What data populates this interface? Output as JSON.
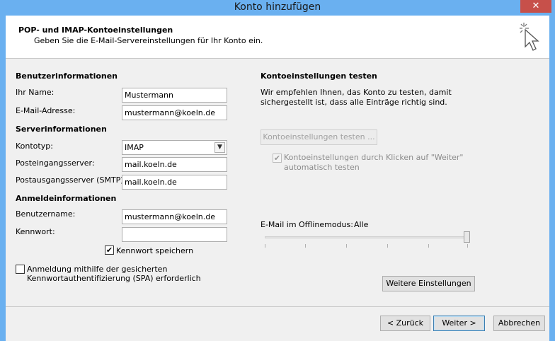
{
  "window": {
    "title": "Konto hinzufügen",
    "close_glyph": "✕"
  },
  "header": {
    "title": "POP- und IMAP-Kontoeinstellungen",
    "subtitle": "Geben Sie die E-Mail-Servereinstellungen für Ihr Konto ein.",
    "icon": "wizard-cursor-icon"
  },
  "user_info": {
    "section": "Benutzerinformationen",
    "name_label": "Ihr Name:",
    "name_value": "Mustermann",
    "email_label": "E-Mail-Adresse:",
    "email_value": "mustermann@koeln.de"
  },
  "server_info": {
    "section": "Serverinformationen",
    "account_type_label": "Kontotyp:",
    "account_type_value": "IMAP",
    "incoming_label": "Posteingangsserver:",
    "incoming_value": "mail.koeln.de",
    "outgoing_label": "Postausgangsserver (SMTP):",
    "outgoing_value": "mail.koeln.de"
  },
  "login_info": {
    "section": "Anmeldeinformationen",
    "username_label": "Benutzername:",
    "username_value": "mustermann@koeln.de",
    "password_label": "Kennwort:",
    "password_value": "",
    "remember_label": "Kennwort speichern",
    "remember_checked": true,
    "spa_label_line1": "Anmeldung mithilfe der gesicherten",
    "spa_label_line2": "Kennwortauthentifizierung (SPA) erforderlich",
    "spa_checked": false
  },
  "test": {
    "section": "Kontoeinstellungen testen",
    "desc_line1": "Wir empfehlen Ihnen, das Konto zu testen, damit",
    "desc_line2": "sichergestellt ist, dass alle Einträge richtig sind.",
    "test_button": "Kontoeinstellungen testen ...",
    "auto_label_line1": "Kontoeinstellungen durch Klicken auf \"Weiter\"",
    "auto_label_line2": "automatisch testen",
    "auto_checked": true
  },
  "offline": {
    "label": "E-Mail im Offlinemodus:",
    "value": "Alle",
    "slider_position": 1.0
  },
  "more_settings_button": "Weitere Einstellungen",
  "footer": {
    "back": "< Zurück",
    "next": "Weiter >",
    "cancel": "Abbrechen"
  }
}
